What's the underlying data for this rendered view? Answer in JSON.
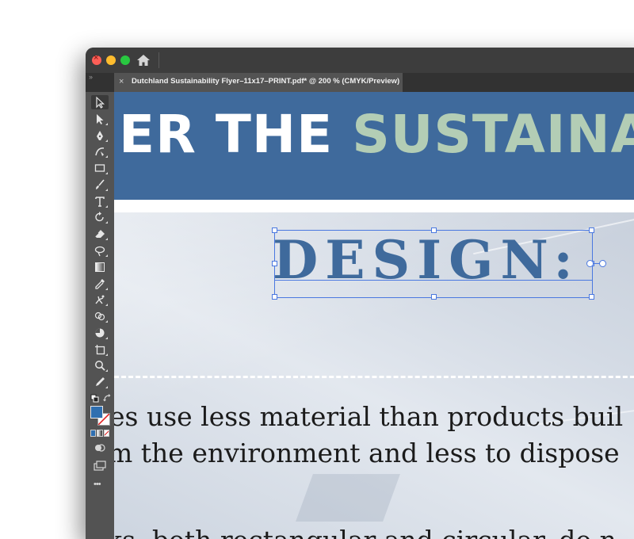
{
  "window": {
    "tab_close": "×",
    "tab_title": "Dutchland Sustainability Flyer–11x17–PRINT.pdf* @ 200 % (CMYK/Preview)",
    "panel_toggle": "››"
  },
  "toolbar": {
    "tools": [
      {
        "name": "selection-tool-icon",
        "active": true
      },
      {
        "name": "direct-selection-tool-icon"
      },
      {
        "name": "pen-tool-icon"
      },
      {
        "name": "curvature-tool-icon"
      },
      {
        "name": "rectangle-tool-icon"
      },
      {
        "name": "paintbrush-tool-icon"
      },
      {
        "name": "type-tool-icon"
      },
      {
        "name": "rotate-tool-icon"
      },
      {
        "name": "eraser-tool-icon"
      },
      {
        "name": "lasso-tool-icon"
      },
      {
        "name": "gradient-tool-icon"
      },
      {
        "name": "eyedropper-tool-icon"
      },
      {
        "name": "puppet-warp-tool-icon"
      },
      {
        "name": "shape-builder-tool-icon"
      },
      {
        "name": "pie-graph-tool-icon"
      },
      {
        "name": "artboard-tool-icon"
      },
      {
        "name": "zoom-tool-icon"
      },
      {
        "name": "knife-tool-icon"
      }
    ],
    "fill_color": "#2f6fb0",
    "more": "•••"
  },
  "canvas": {
    "banner_white": "ER THE ",
    "banner_green": "SUSTAINA",
    "heading": "DESIGN:",
    "line1": "es use less material than products buil",
    "line2": "m the environment and less to dispose",
    "line3": "ks, both rectangular and circular, do n",
    "colors": {
      "banner": "#3f6a9c",
      "green": "#b3cdb5",
      "selection": "#4a78e0"
    }
  }
}
